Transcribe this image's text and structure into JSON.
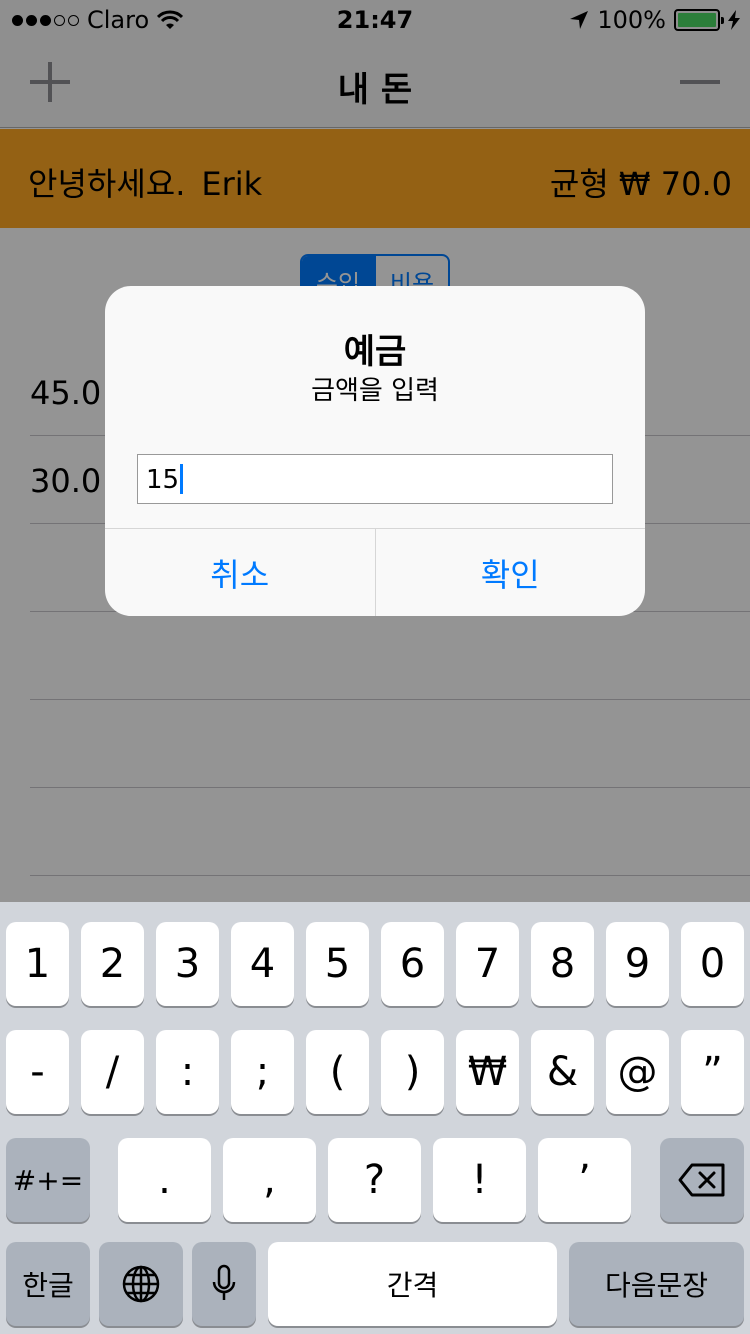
{
  "status_bar": {
    "carrier": "Claro",
    "time": "21:47",
    "battery": "100%"
  },
  "navbar": {
    "title": "내 돈",
    "add_icon": "plus-icon",
    "remove_icon": "minus-icon"
  },
  "banner": {
    "greeting": "안녕하세요.",
    "name": "Erik",
    "balance": "균형 ₩ 70.0",
    "color": "#ffa824"
  },
  "segment": {
    "income": "수입",
    "expense": "비용"
  },
  "entries": [
    "45.0",
    "30.0"
  ],
  "alert": {
    "title": "예금",
    "message": "금액을 입력",
    "input_value": "15",
    "cancel": "취소",
    "confirm": "확인"
  },
  "keyboard": {
    "row1": [
      "1",
      "2",
      "3",
      "4",
      "5",
      "6",
      "7",
      "8",
      "9",
      "0"
    ],
    "row2": [
      "-",
      "/",
      ":",
      ";",
      "(",
      ")",
      "₩",
      "&",
      "@",
      "”"
    ],
    "row3": [
      ".",
      ",",
      "?",
      "!",
      "’"
    ],
    "symbols_key": "#+=",
    "lang_key": "한글",
    "space_key": "간격",
    "return_key": "다음문장"
  },
  "accent_color": "#007aff"
}
